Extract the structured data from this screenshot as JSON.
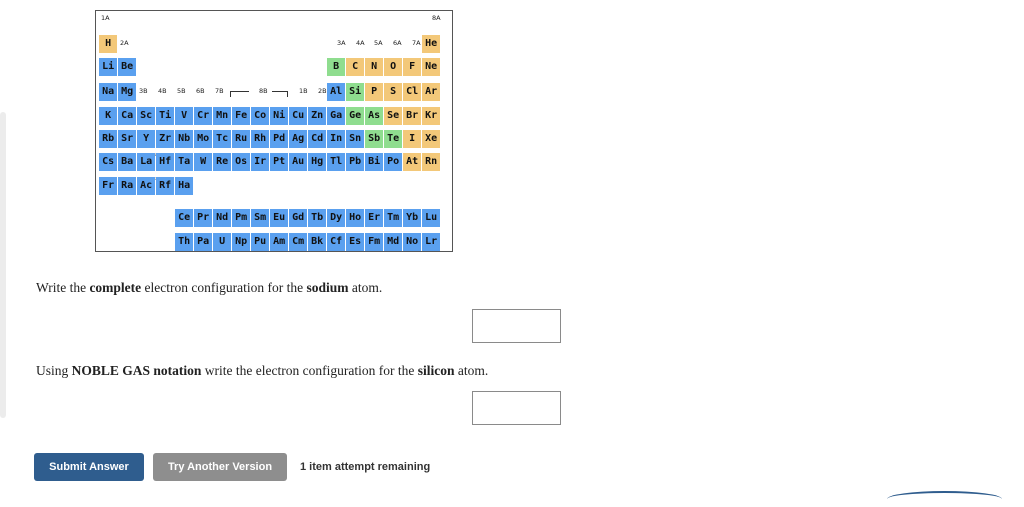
{
  "periodic_table": {
    "group_labels": [
      "1A",
      "2A",
      "3A",
      "4A",
      "5A",
      "6A",
      "7A",
      "8A",
      "3B",
      "4B",
      "5B",
      "6B",
      "7B",
      "8B",
      "1B",
      "2B"
    ],
    "lanthanide_marker": "*",
    "actinide_marker": "**",
    "colors": {
      "metal": "#5aa0ef",
      "nonmetal": "#f3c879",
      "metalloid": "#8fdd8f"
    },
    "rows": [
      [
        {
          "s": "H",
          "t": "nonmetal"
        },
        {
          "s": "He",
          "t": "nonmetal"
        }
      ],
      [
        {
          "s": "Li",
          "t": "metal"
        },
        {
          "s": "Be",
          "t": "metal"
        },
        {
          "s": "B",
          "t": "metalloid"
        },
        {
          "s": "C",
          "t": "nonmetal"
        },
        {
          "s": "N",
          "t": "nonmetal"
        },
        {
          "s": "O",
          "t": "nonmetal"
        },
        {
          "s": "F",
          "t": "nonmetal"
        },
        {
          "s": "Ne",
          "t": "nonmetal"
        }
      ],
      [
        {
          "s": "Na",
          "t": "metal"
        },
        {
          "s": "Mg",
          "t": "metal"
        },
        {
          "s": "Al",
          "t": "metal"
        },
        {
          "s": "Si",
          "t": "metalloid"
        },
        {
          "s": "P",
          "t": "nonmetal"
        },
        {
          "s": "S",
          "t": "nonmetal"
        },
        {
          "s": "Cl",
          "t": "nonmetal"
        },
        {
          "s": "Ar",
          "t": "nonmetal"
        }
      ],
      [
        {
          "s": "K",
          "t": "metal"
        },
        {
          "s": "Ca",
          "t": "metal"
        },
        {
          "s": "Sc",
          "t": "metal"
        },
        {
          "s": "Ti",
          "t": "metal"
        },
        {
          "s": "V",
          "t": "metal"
        },
        {
          "s": "Cr",
          "t": "metal"
        },
        {
          "s": "Mn",
          "t": "metal"
        },
        {
          "s": "Fe",
          "t": "metal"
        },
        {
          "s": "Co",
          "t": "metal"
        },
        {
          "s": "Ni",
          "t": "metal"
        },
        {
          "s": "Cu",
          "t": "metal"
        },
        {
          "s": "Zn",
          "t": "metal"
        },
        {
          "s": "Ga",
          "t": "metal"
        },
        {
          "s": "Ge",
          "t": "metalloid"
        },
        {
          "s": "As",
          "t": "metalloid"
        },
        {
          "s": "Se",
          "t": "nonmetal"
        },
        {
          "s": "Br",
          "t": "nonmetal"
        },
        {
          "s": "Kr",
          "t": "nonmetal"
        }
      ],
      [
        {
          "s": "Rb",
          "t": "metal"
        },
        {
          "s": "Sr",
          "t": "metal"
        },
        {
          "s": "Y",
          "t": "metal"
        },
        {
          "s": "Zr",
          "t": "metal"
        },
        {
          "s": "Nb",
          "t": "metal"
        },
        {
          "s": "Mo",
          "t": "metal"
        },
        {
          "s": "Tc",
          "t": "metal"
        },
        {
          "s": "Ru",
          "t": "metal"
        },
        {
          "s": "Rh",
          "t": "metal"
        },
        {
          "s": "Pd",
          "t": "metal"
        },
        {
          "s": "Ag",
          "t": "metal"
        },
        {
          "s": "Cd",
          "t": "metal"
        },
        {
          "s": "In",
          "t": "metal"
        },
        {
          "s": "Sn",
          "t": "metal"
        },
        {
          "s": "Sb",
          "t": "metalloid"
        },
        {
          "s": "Te",
          "t": "metalloid"
        },
        {
          "s": "I",
          "t": "nonmetal"
        },
        {
          "s": "Xe",
          "t": "nonmetal"
        }
      ],
      [
        {
          "s": "Cs",
          "t": "metal"
        },
        {
          "s": "Ba",
          "t": "metal"
        },
        {
          "s": "La",
          "t": "metal"
        },
        {
          "s": "Hf",
          "t": "metal"
        },
        {
          "s": "Ta",
          "t": "metal"
        },
        {
          "s": "W",
          "t": "metal"
        },
        {
          "s": "Re",
          "t": "metal"
        },
        {
          "s": "Os",
          "t": "metal"
        },
        {
          "s": "Ir",
          "t": "metal"
        },
        {
          "s": "Pt",
          "t": "metal"
        },
        {
          "s": "Au",
          "t": "metal"
        },
        {
          "s": "Hg",
          "t": "metal"
        },
        {
          "s": "Tl",
          "t": "metal"
        },
        {
          "s": "Pb",
          "t": "metal"
        },
        {
          "s": "Bi",
          "t": "metal"
        },
        {
          "s": "Po",
          "t": "metal"
        },
        {
          "s": "At",
          "t": "nonmetal"
        },
        {
          "s": "Rn",
          "t": "nonmetal"
        }
      ],
      [
        {
          "s": "Fr",
          "t": "metal"
        },
        {
          "s": "Ra",
          "t": "metal"
        },
        {
          "s": "Ac",
          "t": "metal"
        },
        {
          "s": "Rf",
          "t": "metal"
        },
        {
          "s": "Ha",
          "t": "metal"
        }
      ],
      [
        {
          "s": "Ce",
          "t": "metal"
        },
        {
          "s": "Pr",
          "t": "metal"
        },
        {
          "s": "Nd",
          "t": "metal"
        },
        {
          "s": "Pm",
          "t": "metal"
        },
        {
          "s": "Sm",
          "t": "metal"
        },
        {
          "s": "Eu",
          "t": "metal"
        },
        {
          "s": "Gd",
          "t": "metal"
        },
        {
          "s": "Tb",
          "t": "metal"
        },
        {
          "s": "Dy",
          "t": "metal"
        },
        {
          "s": "Ho",
          "t": "metal"
        },
        {
          "s": "Er",
          "t": "metal"
        },
        {
          "s": "Tm",
          "t": "metal"
        },
        {
          "s": "Yb",
          "t": "metal"
        },
        {
          "s": "Lu",
          "t": "metal"
        }
      ],
      [
        {
          "s": "Th",
          "t": "metal"
        },
        {
          "s": "Pa",
          "t": "metal"
        },
        {
          "s": "U",
          "t": "metal"
        },
        {
          "s": "Np",
          "t": "metal"
        },
        {
          "s": "Pu",
          "t": "metal"
        },
        {
          "s": "Am",
          "t": "metal"
        },
        {
          "s": "Cm",
          "t": "metal"
        },
        {
          "s": "Bk",
          "t": "metal"
        },
        {
          "s": "Cf",
          "t": "metal"
        },
        {
          "s": "Es",
          "t": "metal"
        },
        {
          "s": "Fm",
          "t": "metal"
        },
        {
          "s": "Md",
          "t": "metal"
        },
        {
          "s": "No",
          "t": "metal"
        },
        {
          "s": "Lr",
          "t": "metal"
        }
      ]
    ]
  },
  "questions": [
    {
      "parts": [
        "Write the ",
        "complete",
        " electron configuration for the ",
        "sodium",
        " atom."
      ],
      "answer_value": ""
    },
    {
      "parts": [
        "Using ",
        "NOBLE GAS notation",
        " write the electron configuration for the ",
        "silicon",
        " atom."
      ],
      "answer_value": ""
    }
  ],
  "actions": {
    "submit_label": "Submit Answer",
    "another_version_label": "Try Another Version",
    "attempts_text": "1 item attempt remaining"
  }
}
